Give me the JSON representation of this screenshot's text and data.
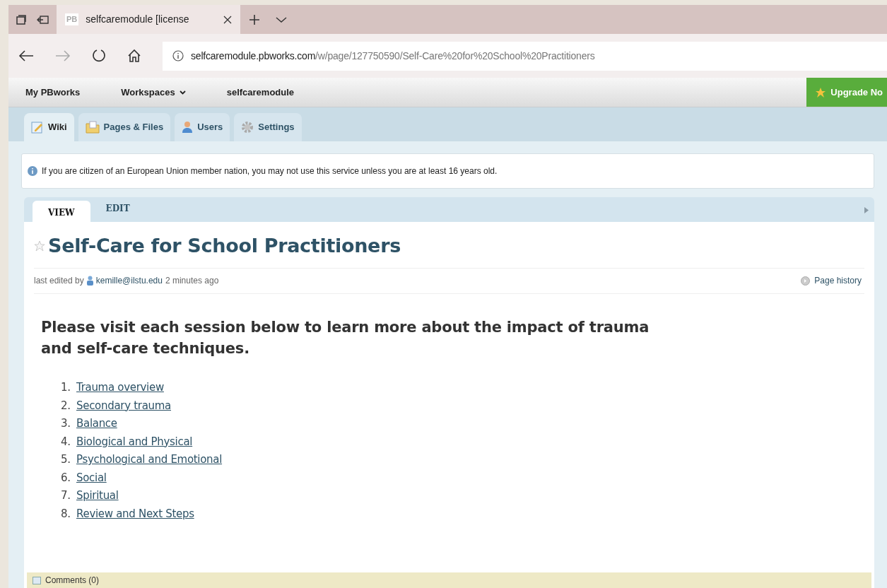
{
  "browser": {
    "tabs": [
      {
        "favicon": "PB",
        "title": "selfcaremodule [license",
        "selected": true
      }
    ],
    "address": {
      "host": "selfcaremodule.pbworks.com",
      "path": "/w/page/127750590/Self-Care%20for%20School%20Practitioners"
    }
  },
  "breadcrumbs": [
    {
      "label": "My PBworks",
      "dropdown": false
    },
    {
      "label": "Workspaces",
      "dropdown": true
    },
    {
      "label": "selfcaremodule",
      "dropdown": false
    }
  ],
  "upgrade_button": "Upgrade No",
  "app_tabs": [
    {
      "label": "Wiki",
      "kind": "wiki",
      "selected": true
    },
    {
      "label": "Pages & Files",
      "kind": "pages",
      "selected": false
    },
    {
      "label": "Users",
      "kind": "users",
      "selected": false
    },
    {
      "label": "Settings",
      "kind": "settings",
      "selected": false
    }
  ],
  "notice": "If you are citizen of an European Union member nation, you may not use this service unless you are at least 16 years old.",
  "page_tabs": [
    {
      "label": "VIEW",
      "selected": true
    },
    {
      "label": "EDIT",
      "selected": false
    }
  ],
  "page": {
    "title": "Self-Care for School Practitioners",
    "starred": false,
    "meta": {
      "prefix": "last edited by",
      "user": "kemille@ilstu.edu",
      "suffix": "2 minutes ago"
    },
    "page_history": "Page history",
    "intro": "Please visit each session below to learn more about the impact of trauma and self-care techniques.",
    "sessions": [
      {
        "number": "1.",
        "label": "Trauma overview"
      },
      {
        "number": "2.",
        "label": "Secondary trauma"
      },
      {
        "number": "3.",
        "label": "Balance"
      },
      {
        "number": "4.",
        "label": "Biological and Physical"
      },
      {
        "number": "5.",
        "label": "Psychological and Emotional"
      },
      {
        "number": "6.",
        "label": "Social"
      },
      {
        "number": "7.",
        "label": "Spiritual"
      },
      {
        "number": "8.",
        "label": "Review and Next Steps"
      }
    ],
    "comments": "Comments (0)"
  }
}
